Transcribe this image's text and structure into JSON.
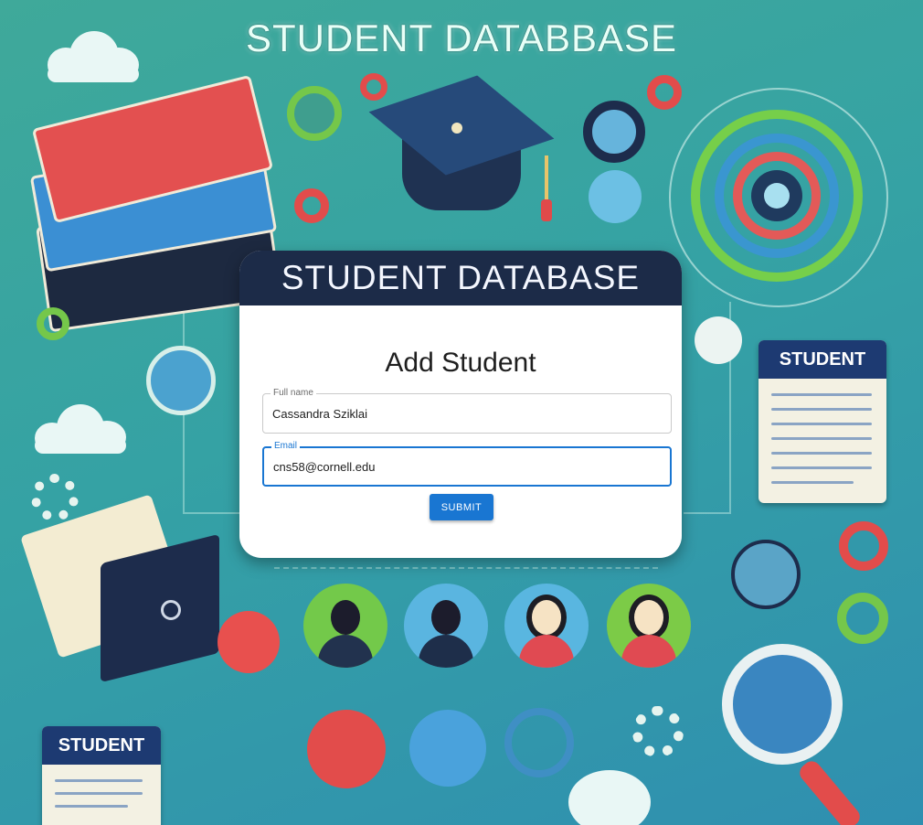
{
  "banner": {
    "title": "STUDENT DATABBASE"
  },
  "card": {
    "header_title": "STUDENT DATABASE",
    "form_title": "Add Student",
    "fields": {
      "full_name": {
        "label": "Full name",
        "value": "Cassandra Sziklai"
      },
      "email": {
        "label": "Email",
        "value": "cns58@cornell.edu"
      }
    },
    "submit_label": "SUBMIT"
  },
  "decor": {
    "right_clipboard_title": "STUDENT",
    "left_clipboard_title": "STUDENT"
  },
  "colors": {
    "primary": "#1976d2",
    "header_bg": "#1c2b48",
    "bg_start": "#3fa99a",
    "bg_end": "#2f8fb0"
  }
}
